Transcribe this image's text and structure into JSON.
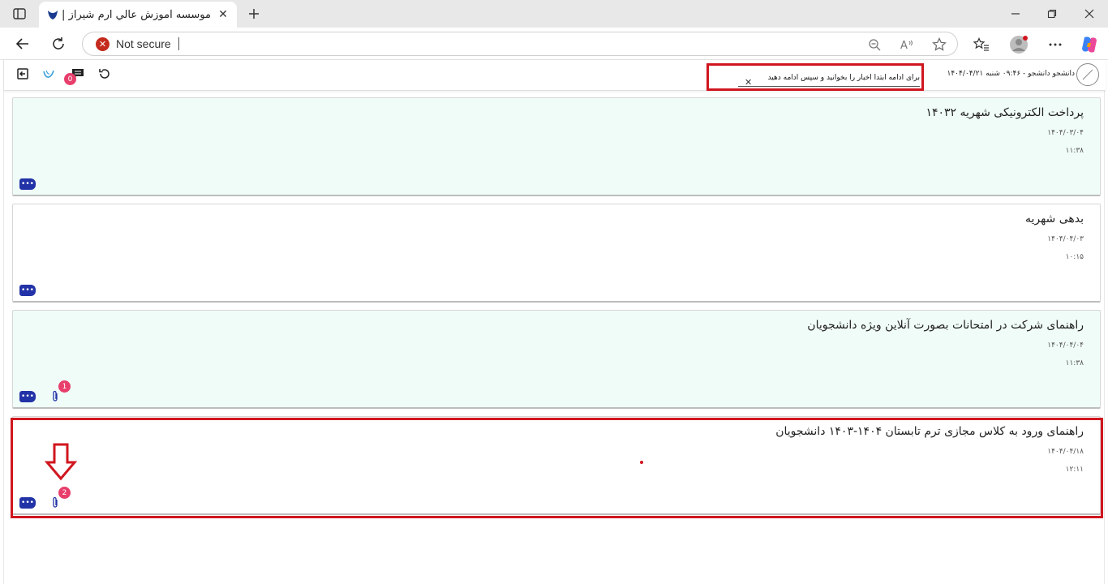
{
  "browser": {
    "tab_title": "موسسه آموزش عالي ارم شيراز | شر",
    "security_label": "Not secure"
  },
  "header": {
    "notice_text": "برای ادامه ابتدا اخبار را بخوانید و سپس ادامه دهید",
    "user_info": "دانشجو دانشجو - ۰۹:۴۶ شنبه ۱۴۰۴/۰۴/۲۱",
    "messages_badge": "0"
  },
  "news": [
    {
      "title": "پرداخت الکترونیکی شهریه ۱۴۰۳۲",
      "date": "۱۴۰۴/۰۳/۰۴",
      "time": "۱۱:۳۸",
      "attachments": null
    },
    {
      "title": "بدهی شهریه",
      "date": "۱۴۰۴/۰۴/۰۳",
      "time": "۱۰:۱۵",
      "attachments": null
    },
    {
      "title": "راهنمای شرکت در امتحانات بصورت آنلاین ویژه دانشجویان",
      "date": "۱۴۰۴/۰۴/۰۴",
      "time": "۱۱:۳۸",
      "attachments": "1"
    },
    {
      "title": "راهنمای ورود به کلاس مجازی ترم تابستان ۱۴۰۴-۱۴۰۳ دانشجویان",
      "date": "۱۴۰۴/۰۴/۱۸",
      "time": "۱۲:۱۱",
      "attachments": "2"
    }
  ],
  "colors": {
    "accent_blue": "#2233a8",
    "badge_pink": "#e83e6c",
    "annotation_red": "#d0161f",
    "card_tint": "#f0fcf7"
  },
  "icons": [
    "tab-actions-icon",
    "favicon-icon",
    "close-icon",
    "plus-icon",
    "minimize-icon",
    "maximize-icon",
    "back-icon",
    "reload-icon",
    "zoom-out-icon",
    "read-aloud-icon",
    "favorite-star-icon",
    "favorites-icon",
    "profile-icon",
    "more-icon",
    "copilot-icon",
    "logout-icon",
    "logo-icon",
    "messages-icon",
    "refresh-icon",
    "more-dots-icon",
    "paperclip-icon",
    "down-arrow-icon"
  ]
}
